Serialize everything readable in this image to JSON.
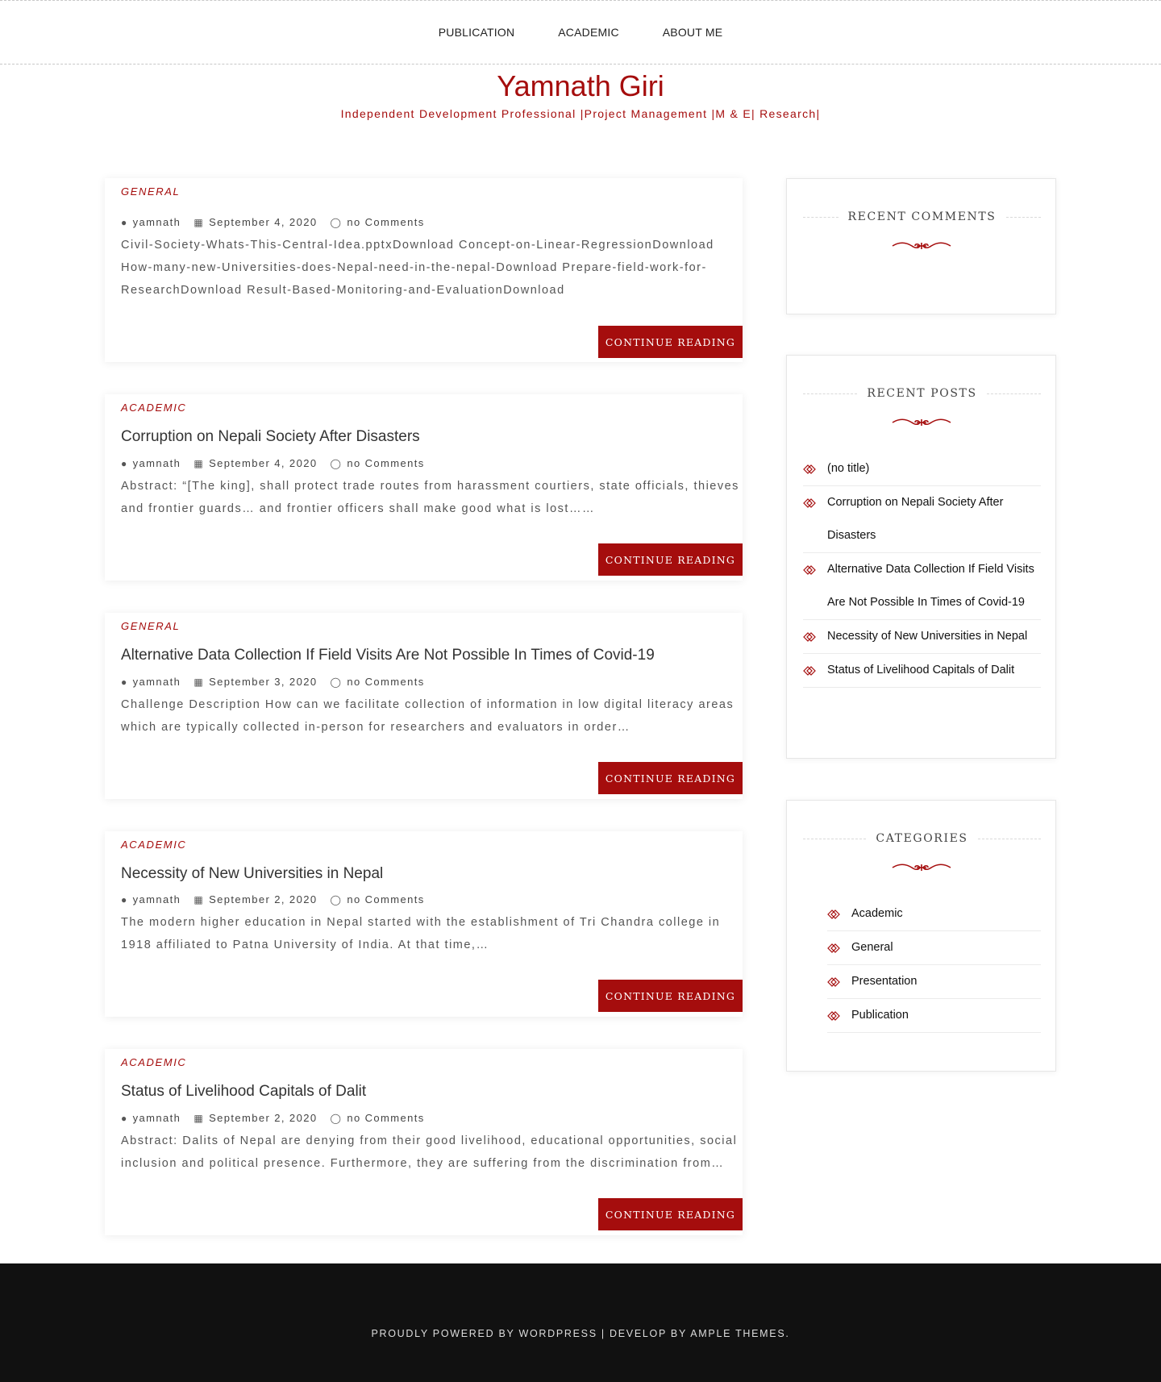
{
  "nav": {
    "items": [
      "PUBLICATION",
      "ACADEMIC",
      "ABOUT ME"
    ]
  },
  "site": {
    "title": "Yamnath Giri",
    "tagline": "Independent Development Professional |Project Management |M & E| Research|"
  },
  "colors": {
    "accent": "#a50d0d",
    "footer_bg": "#111111"
  },
  "icons": {
    "author": "user-icon",
    "date": "calendar-icon",
    "comments": "comment-icon",
    "bullet": "ornament-bullet-icon",
    "divider": "ornament-divider-icon"
  },
  "posts": [
    {
      "category": "GENERAL",
      "title": "",
      "author": "yamnath",
      "date": "September 4, 2020",
      "comments": "no Comments",
      "excerpt": "Civil-Society-Whats-This-Central-Idea.pptxDownload Concept-on-Linear-RegressionDownload How-many-new-Universities-does-Nepal-need-in-the-nepal-Download Prepare-field-work-for-ResearchDownload Result-Based-Monitoring-and-EvaluationDownload",
      "button": "CONTINUE READING"
    },
    {
      "category": "ACADEMIC",
      "title": "Corruption on Nepali Society After Disasters",
      "author": "yamnath",
      "date": "September 4, 2020",
      "comments": "no Comments",
      "excerpt": "Abstract: “[The king], shall protect trade routes from harassment courtiers, state officials, thieves and frontier guards… and frontier officers shall make good what is lost……",
      "button": "CONTINUE READING"
    },
    {
      "category": "GENERAL",
      "title": "Alternative Data Collection If Field Visits Are Not Possible In Times of Covid-19",
      "author": "yamnath",
      "date": "September 3, 2020",
      "comments": "no Comments",
      "excerpt": "Challenge Description How can we facilitate collection of information in low digital literacy areas which are typically collected in-person for researchers and evaluators in order…",
      "button": "CONTINUE READING"
    },
    {
      "category": "ACADEMIC",
      "title": "Necessity of New Universities in Nepal",
      "author": "yamnath",
      "date": "September 2, 2020",
      "comments": "no Comments",
      "excerpt": "The modern higher education in Nepal started with the establishment of Tri Chandra college in 1918 affiliated to Patna University of India. At that time,…",
      "button": "CONTINUE READING"
    },
    {
      "category": "ACADEMIC",
      "title": "Status of Livelihood Capitals of Dalit",
      "author": "yamnath",
      "date": "September 2, 2020",
      "comments": "no Comments",
      "excerpt": "Abstract: Dalits of Nepal are denying from their good livelihood, educational opportunities, social inclusion and political presence. Furthermore, they are suffering from the discrimination from…",
      "button": "CONTINUE READING"
    }
  ],
  "sidebar": {
    "recent_comments": {
      "title": "RECENT COMMENTS"
    },
    "recent_posts": {
      "title": "RECENT POSTS",
      "items": [
        "(no title)",
        "Corruption on Nepali Society After Disasters",
        "Alternative Data Collection If Field Visits Are Not Possible In Times of Covid-19",
        "Necessity of New Universities in Nepal",
        "Status of Livelihood Capitals of Dalit"
      ]
    },
    "categories": {
      "title": "CATEGORIES",
      "items": [
        "Academic",
        "General",
        "Presentation",
        "Publication"
      ]
    }
  },
  "footer": {
    "text": "PROUDLY POWERED BY WORDPRESS | DEVELOP BY AMPLE THEMES."
  }
}
